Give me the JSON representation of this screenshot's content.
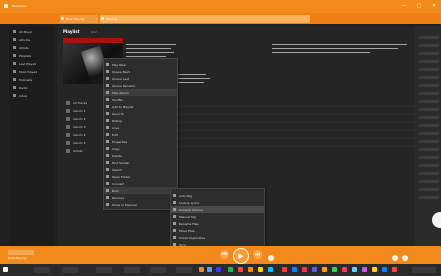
{
  "window": {
    "titlebar_text": "MusicBee",
    "tab_active": "Playing",
    "tab_other": "Now Playing",
    "close_symbol": "✕",
    "max_symbol": "□",
    "min_symbol": "—"
  },
  "sidebar": {
    "items": [
      {
        "label": "All Music"
      },
      {
        "label": "Albums"
      },
      {
        "label": "Artists"
      },
      {
        "label": "Playlists"
      },
      {
        "label": "Last Played"
      },
      {
        "label": "Most Played"
      },
      {
        "label": "Podcasts"
      },
      {
        "label": "Radio"
      },
      {
        "label": "Inbox"
      },
      {
        "label": "Tagging"
      }
    ]
  },
  "header": {
    "view_label": "Playlist",
    "view_count": "112"
  },
  "tracks": {
    "items": [
      {
        "label": "All Tracks"
      },
      {
        "label": "Album 1"
      },
      {
        "label": "Album 2"
      },
      {
        "label": "Album 3"
      },
      {
        "label": "Album 4"
      },
      {
        "label": "Album 5"
      },
      {
        "label": "Artists"
      },
      {
        "label": "Genres"
      }
    ]
  },
  "context_menu": {
    "items": [
      {
        "label": "Play Now"
      },
      {
        "label": "Queue Next"
      },
      {
        "label": "Queue Last"
      },
      {
        "label": "Queue Random"
      },
      {
        "label": "Play Album"
      },
      {
        "label": "Shuffle"
      },
      {
        "label": "Add to Playlist"
      },
      {
        "label": "Send To"
      },
      {
        "label": "Rating"
      },
      {
        "label": "Love"
      },
      {
        "label": "Edit"
      },
      {
        "label": "Properties"
      },
      {
        "label": "Copy"
      },
      {
        "label": "Delete"
      },
      {
        "label": "Find Similar"
      },
      {
        "label": "Search"
      },
      {
        "label": "Open Folder"
      },
      {
        "label": "Convert"
      },
      {
        "label": "Burn"
      },
      {
        "label": "Remove"
      },
      {
        "label": "Show in Explorer"
      },
      {
        "label": "Tools"
      },
      {
        "label": "Help"
      }
    ]
  },
  "submenu": {
    "items": [
      {
        "label": "Auto-Tag"
      },
      {
        "label": "Lookup Lyrics"
      },
      {
        "label": "Analyze Volume"
      },
      {
        "label": "Manual Tag"
      },
      {
        "label": "Rename Files"
      },
      {
        "label": "Move Files"
      },
      {
        "label": "Check Duplicates"
      },
      {
        "label": "Sync"
      }
    ]
  },
  "player": {
    "play_symbol": "▶",
    "prev_symbol": "⏮",
    "next_symbol": "⏭",
    "now_playing": "Now Playing"
  }
}
